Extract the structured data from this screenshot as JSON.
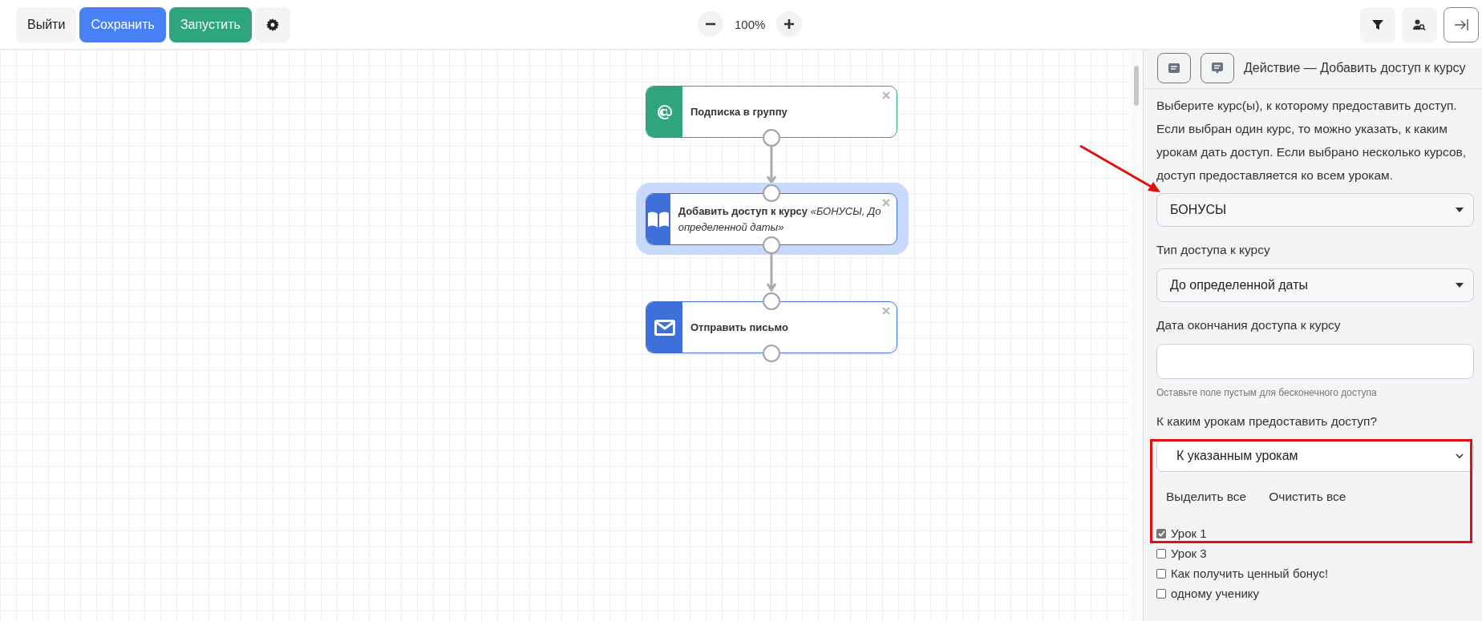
{
  "toolbar": {
    "buttons": [
      {
        "label": "Выйти",
        "kind": "plain"
      },
      {
        "label": "Сохранить",
        "kind": "primary"
      },
      {
        "label": "Запустить",
        "kind": "success"
      }
    ],
    "zoom": "100%"
  },
  "canvas": {
    "nodes": [
      {
        "kind": "subscribe",
        "title": "Подписка в группу",
        "color": "#2ea57a",
        "selected": false
      },
      {
        "kind": "course",
        "title": "Добавить доступ к курсу",
        "detail": "«БОНУСЫ, До определенной даты»",
        "color": "#3f6fd8",
        "selected": true
      },
      {
        "kind": "email",
        "title": "Отправить письмо",
        "color": "#3f6fd8",
        "selected": false
      }
    ]
  },
  "panel": {
    "title": "Действие — Добавить доступ к курсу",
    "description": "Выберите курс(ы), к которому предоставить доступ. Если выбран один курс, то можно указать, к каким урокам дать доступ. Если выбрано несколько курсов, доступ предоставляется ко всем урокам.",
    "course_select": {
      "value": "БОНУСЫ"
    },
    "access_type": {
      "label": "Тип доступа к курсу",
      "value": "До определенной даты"
    },
    "end_date": {
      "label": "Дата окончания доступа к курсу",
      "hint": "Оставьте поле пустым для бесконечного доступа"
    },
    "lessons_access": {
      "label": "К каким урокам предоставить доступ?",
      "value": "К указанным урокам"
    },
    "links": [
      "Выделить все",
      "Очистить все"
    ],
    "lessons": [
      {
        "label": "Урок 1",
        "checked": true
      },
      {
        "label": "Урок 3",
        "checked": false
      },
      {
        "label": "Как получить ценный бонус!",
        "checked": false
      },
      {
        "label": "одному ученику",
        "checked": false
      }
    ]
  }
}
